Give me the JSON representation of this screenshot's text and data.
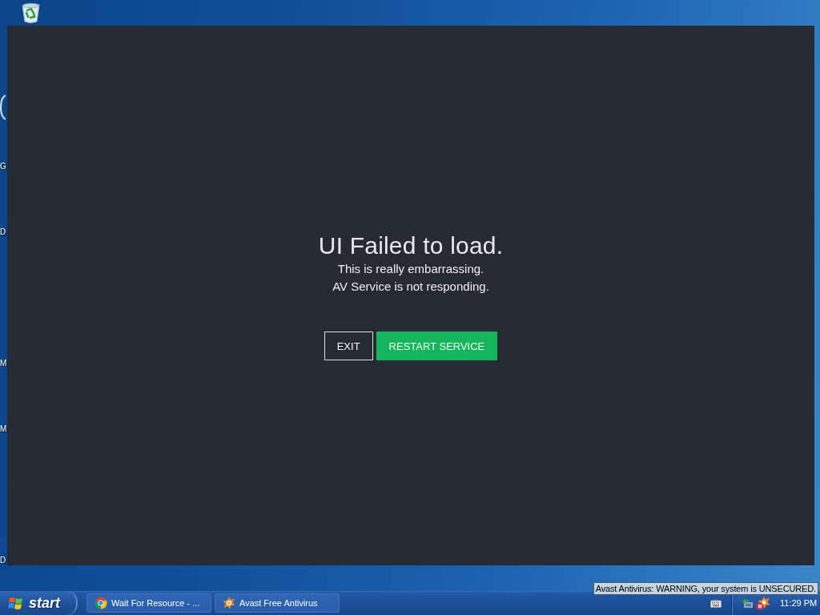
{
  "desktop": {
    "edge_labels": [
      "G",
      "D",
      "M",
      "M",
      "D"
    ]
  },
  "window": {
    "title": "UI Failed to load.",
    "lines": [
      "This is really embarrassing.",
      "AV Service is not responding."
    ],
    "buttons": [
      {
        "label": "EXIT",
        "kind": "outline"
      },
      {
        "label": "RESTART SERVICE",
        "kind": "primary"
      }
    ]
  },
  "taskbar": {
    "start": "start",
    "tasks": [
      {
        "label": "Wait For Resource - ...",
        "kind": "browser"
      },
      {
        "label": "Avast Free Antivirus",
        "kind": "antivirus"
      }
    ],
    "clock": "11:29 PM"
  },
  "tooltip": "Avast Antivirus: WARNING, your system is UNSECURED."
}
